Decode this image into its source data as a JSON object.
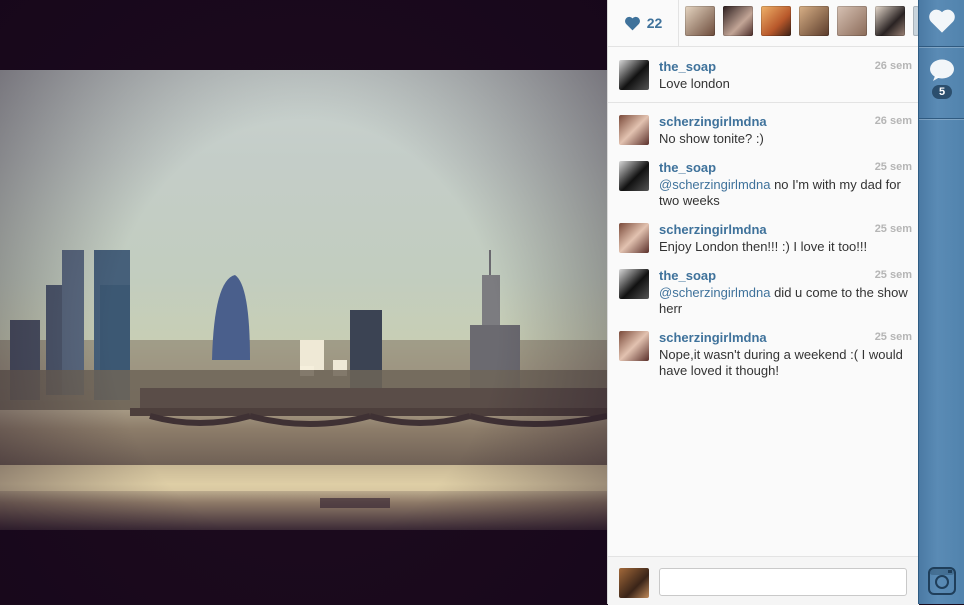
{
  "post": {
    "like_count": "22",
    "comment_count": "5"
  },
  "comments": [
    {
      "user": "the_soap",
      "time": "26 sem",
      "text": "Love london",
      "mention": ""
    },
    {
      "user": "scherzingirlmdna",
      "time": "26 sem",
      "text": "No show tonite? :)",
      "mention": ""
    },
    {
      "user": "the_soap",
      "time": "25 sem",
      "mention": "@scherzingirlmdna",
      "text": " no I'm with my dad for two weeks"
    },
    {
      "user": "scherzingirlmdna",
      "time": "25 sem",
      "text": "Enjoy London then!!! :) I love it too!!!",
      "mention": ""
    },
    {
      "user": "the_soap",
      "time": "25 sem",
      "mention": "@scherzingirlmdna",
      "text": " did u come to the show herr"
    },
    {
      "user": "scherzingirlmdna",
      "time": "25 sem",
      "text": "Nope,it wasn't during a weekend :( I would have loved it though!",
      "mention": ""
    }
  ],
  "comment_input": {
    "value": "",
    "placeholder": ""
  },
  "colors": {
    "accent": "#3f729b",
    "rail": "#5183ad",
    "time": "#b5b5b5"
  },
  "icons": [
    "heart-icon",
    "comment-icon",
    "camera-icon"
  ]
}
